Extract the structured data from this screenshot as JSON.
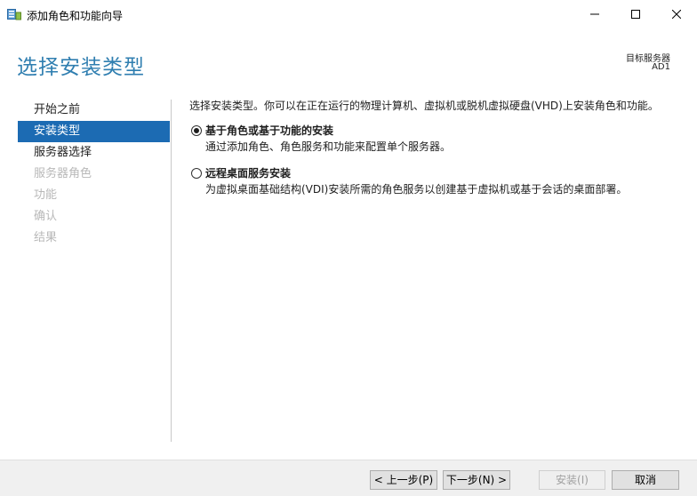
{
  "window": {
    "title": "添加角色和功能向导",
    "icon": "server-manager-icon",
    "controls": {
      "minimize": "minimize-icon",
      "maximize": "maximize-icon",
      "close": "close-icon"
    }
  },
  "header": {
    "page_title": "选择安装类型",
    "target_server_label": "目标服务器",
    "target_server_name": "AD1"
  },
  "nav": {
    "items": [
      {
        "label": "开始之前",
        "state": "normal"
      },
      {
        "label": "安装类型",
        "state": "active"
      },
      {
        "label": "服务器选择",
        "state": "normal"
      },
      {
        "label": "服务器角色",
        "state": "disabled"
      },
      {
        "label": "功能",
        "state": "disabled"
      },
      {
        "label": "确认",
        "state": "disabled"
      },
      {
        "label": "结果",
        "state": "disabled"
      }
    ]
  },
  "content": {
    "intro": "选择安装类型。你可以在正在运行的物理计算机、虚拟机或脱机虚拟硬盘(VHD)上安装角色和功能。",
    "options": [
      {
        "label": "基于角色或基于功能的安装",
        "description": "通过添加角色、角色服务和功能来配置单个服务器。",
        "selected": true
      },
      {
        "label": "远程桌面服务安装",
        "description": "为虚拟桌面基础结构(VDI)安装所需的角色服务以创建基于虚拟机或基于会话的桌面部署。",
        "selected": false
      }
    ]
  },
  "footer": {
    "prev": "< 上一步(P)",
    "next": "下一步(N) >",
    "install": "安装(I)",
    "cancel": "取消"
  },
  "colors": {
    "accent": "#1c6bb3",
    "title": "#2f7eb0",
    "disabled_text": "#b8b8b8"
  }
}
